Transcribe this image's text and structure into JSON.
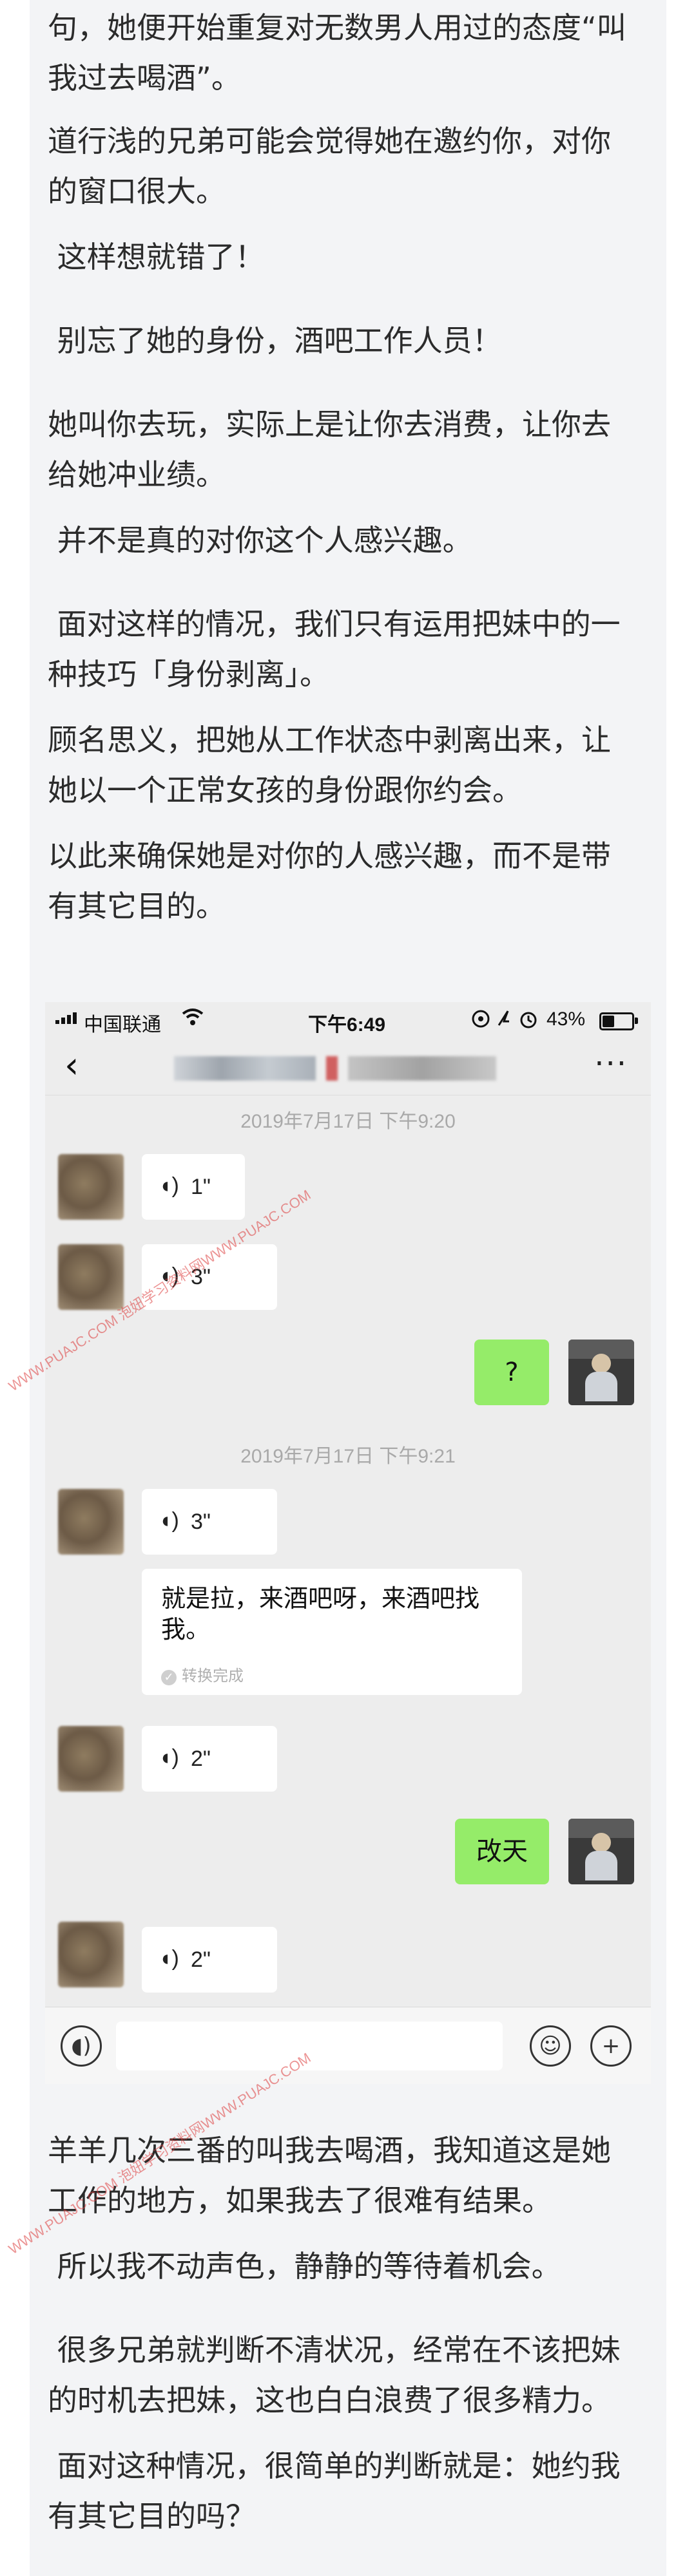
{
  "article": {
    "p0": "句，她便开始重复对无数男人用过的态度“叫\n我过去喝酒”。",
    "p1": "道行浅的兄弟可能会觉得她在邀约你，对你\n的窗口很大。",
    "p2": " 这样想就错了！",
    "p3": " 别忘了她的身份，酒吧工作人员！",
    "p4": "她叫你去玩，实际上是让你去消费，让你去\n给她冲业绩。",
    "p5": " 并不是真的对你这个人感兴趣。",
    "p6": " 面对这样的情况，我们只有运用把妹中的一\n种技巧「身份剥离」。",
    "p7": "顾名思义，把她从工作状态中剥离出来，让\n她以一个正常女孩的身份跟你约会。",
    "p8": "以此来确保她是对你的人感兴趣，而不是带\n有其它目的。",
    "p9": "羊羊几次三番的叫我去喝酒，我知道这是她\n工作的地方，如果我去了很难有结果。",
    "p10": " 所以我不动声色，静静的等待着机会。",
    "p11": " 很多兄弟就判断不清状况，经常在不该把妹\n的时机去把妹，这也白白浪费了很多精力。",
    "p12": " 面对这种情况，很简单的判断就是：她约我\n有其它目的吗？"
  },
  "chat": {
    "status": {
      "carrier": "中国联通",
      "time": "下午6:49",
      "battery": "43%"
    },
    "timestamps": [
      "2019年7月17日 下午9:20",
      "2019年7月17日 下午9:21"
    ],
    "voice_durations": [
      "1\"",
      "3\"",
      "3\"",
      "2\"",
      "2\""
    ],
    "my_messages": [
      "?",
      "改天"
    ],
    "transcript": "就是拉，来酒吧呀，来酒吧找我。",
    "transcript_status": "转换完成",
    "icons": [
      "back-icon",
      "more-icon",
      "voice-input-icon",
      "emoji-icon",
      "plus-icon",
      "voice-wave-icon",
      "wifi-icon",
      "battery-icon"
    ]
  },
  "watermark": "WWW.PUAJC.COM 泡妞学习资料网WWW.PUAJC.COM",
  "colors": {
    "page_bg": "#f3f4f6",
    "text": "#2b2b2b",
    "chat_bg": "#ededed",
    "my_bubble": "#95ec69",
    "watermark": "#dc3c3c"
  }
}
